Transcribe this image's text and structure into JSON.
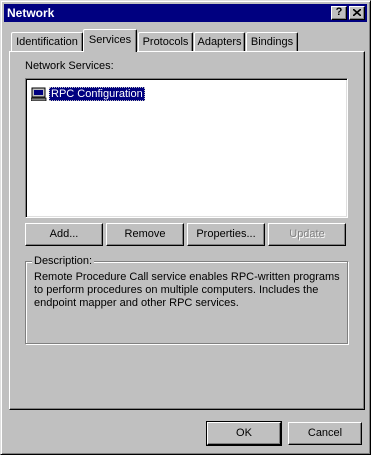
{
  "window": {
    "title": "Network",
    "help_label": "?",
    "close_icon": "close-icon"
  },
  "tabs": [
    {
      "label": "Identification",
      "active": false
    },
    {
      "label": "Services",
      "active": true
    },
    {
      "label": "Protocols",
      "active": false
    },
    {
      "label": "Adapters",
      "active": false
    },
    {
      "label": "Bindings",
      "active": false
    }
  ],
  "services": {
    "list_label": "Network Services:",
    "items": [
      {
        "label": "RPC Configuration",
        "icon": "network-service-icon",
        "selected": true
      }
    ],
    "buttons": {
      "add": "Add...",
      "remove": "Remove",
      "properties": "Properties...",
      "update": "Update"
    },
    "description_label": "Description:",
    "description_text": "Remote Procedure Call service enables RPC-written programs to perform procedures on multiple computers. Includes the endpoint mapper and other RPC services."
  },
  "footer": {
    "ok": "OK",
    "cancel": "Cancel"
  }
}
